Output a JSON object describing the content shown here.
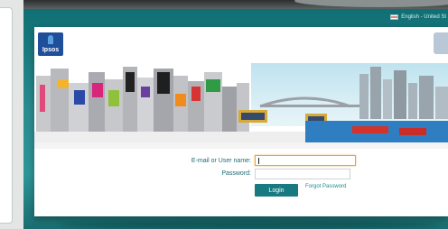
{
  "header": {
    "language_label": "English - United St"
  },
  "brand": {
    "logo_text": "Ipsos"
  },
  "login_form": {
    "email_label": "E-mail or User name:",
    "email_value": "",
    "password_label": "Password:",
    "password_value": "",
    "login_button": "Login",
    "forgot_password": "Forgot Password"
  },
  "colors": {
    "page_teal": "#2a8d90",
    "button_teal": "#177a80",
    "focus_orange": "#e7a33a",
    "logo_blue": "#1f4e9a"
  }
}
